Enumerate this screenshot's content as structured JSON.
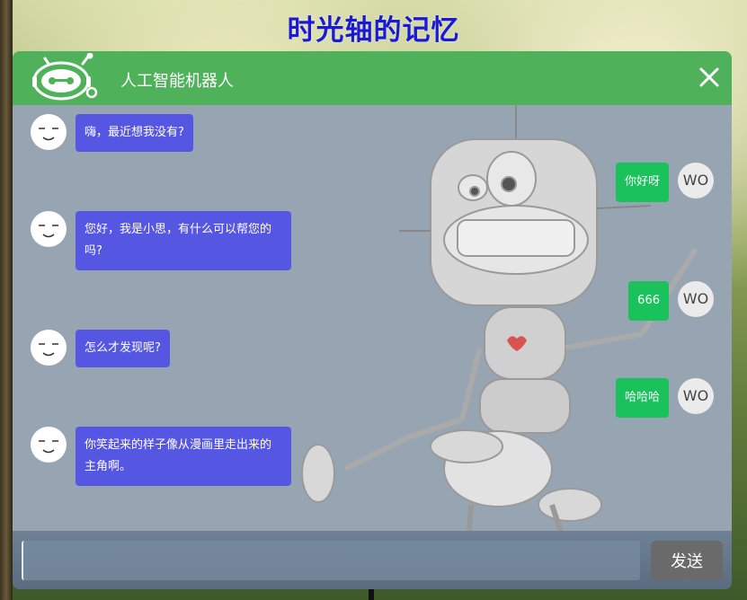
{
  "page": {
    "title": "时光轴的记忆"
  },
  "chat": {
    "header": {
      "title": "人工智能机器人",
      "logo_icon": "robot-icon",
      "close_icon": "close-icon"
    },
    "bot_messages": [
      {
        "text": "嗨，最近想我没有?"
      },
      {
        "text": "您好，我是小思，有什么可以帮您的吗?"
      },
      {
        "text": "怎么才发现呢?"
      },
      {
        "text": "你笑起来的样子像从漫画里走出来的主角啊。"
      }
    ],
    "user_messages": [
      {
        "text": "你好呀",
        "avatar": "WO"
      },
      {
        "text": "666",
        "avatar": "WO"
      },
      {
        "text": "哈哈哈",
        "avatar": "WO"
      }
    ],
    "input": {
      "value": "",
      "placeholder": ""
    },
    "send_label": "发送"
  },
  "colors": {
    "header": "#4fb25a",
    "bot_bubble": "#5557e3",
    "user_bubble": "#19c25b",
    "title": "#1a1ad6"
  }
}
